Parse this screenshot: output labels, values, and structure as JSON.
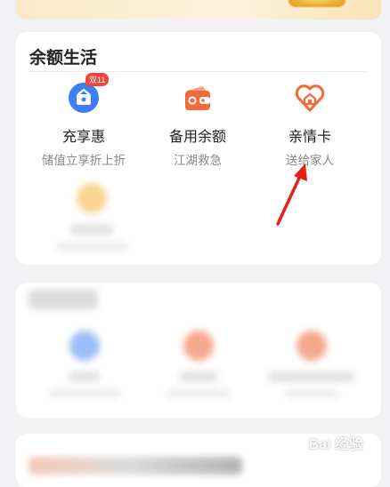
{
  "section": {
    "title": "余额生活",
    "services": [
      {
        "name": "充享惠",
        "desc": "储值立享折上折",
        "badge": "双11",
        "icon": "gift-shop-icon",
        "color": "#3d7ff5"
      },
      {
        "name": "备用余额",
        "desc": "江湖救急",
        "icon": "wallet-icon",
        "color": "#f06a3a"
      },
      {
        "name": "亲情卡",
        "desc": "送给家人",
        "icon": "heart-home-icon",
        "color": "#f06a3a"
      }
    ]
  },
  "colors": {
    "accent_blue": "#3d7ff5",
    "accent_orange": "#f06a3a",
    "annotation_red": "#e8201a"
  },
  "watermark": "Bai 经验"
}
